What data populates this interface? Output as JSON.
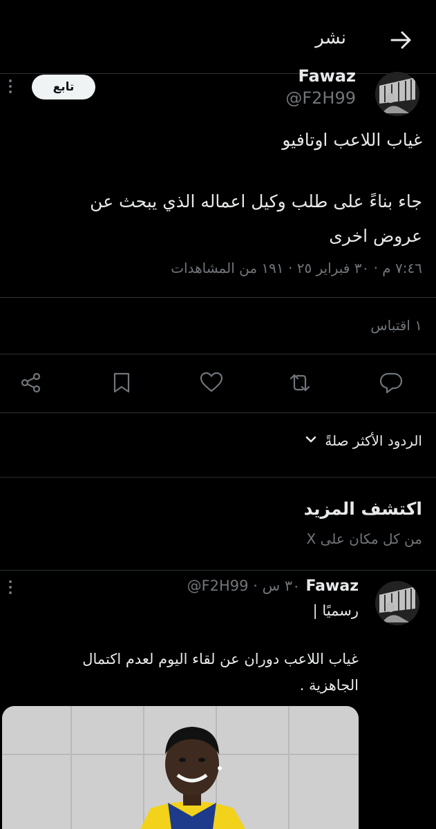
{
  "header": {
    "title": "نشر"
  },
  "tweet": {
    "display_name": "Fawaz",
    "handle": "@F2H99",
    "follow_label": "تابع",
    "text_line1": "غياب اللاعب اوتافيو",
    "text_line2": "جاء بناءً على طلب وكيل اعماله الذي يبحث عن",
    "text_line3": "عروض اخرى",
    "meta": "٧:٤٦ م · ٣٠ فبراير ٢٥ · ١٩١ من المشاهدات",
    "quotes": "١ اقتباس"
  },
  "replies_sort": {
    "label": "الردود الأكثر صلةً"
  },
  "discover": {
    "title": "اكتشف المزيد",
    "subtitle": "من كل مكان على X"
  },
  "related_tweet": {
    "display_name": "Fawaz",
    "handle_time": "@F2H99 · ٣٠ س",
    "text_line1": "رسميًا |",
    "text_line2": "غياب اللاعب دوران عن لقاء اليوم لعدم اكتمال",
    "text_line3": "الجاهزية ."
  },
  "colors": {
    "background": "#000000",
    "text": "#e7e9ea",
    "muted": "#71767b",
    "divider": "#2f3336",
    "kit_yellow": "#f2d21b",
    "kit_blue": "#1d3b8a"
  },
  "icons": {
    "back": "arrow-right-icon",
    "more": "more-vertical-icon",
    "share": "share-icon",
    "bookmark": "bookmark-icon",
    "like": "heart-icon",
    "retweet": "retweet-icon",
    "reply": "reply-bubble-icon",
    "chevron": "chevron-down-icon"
  }
}
